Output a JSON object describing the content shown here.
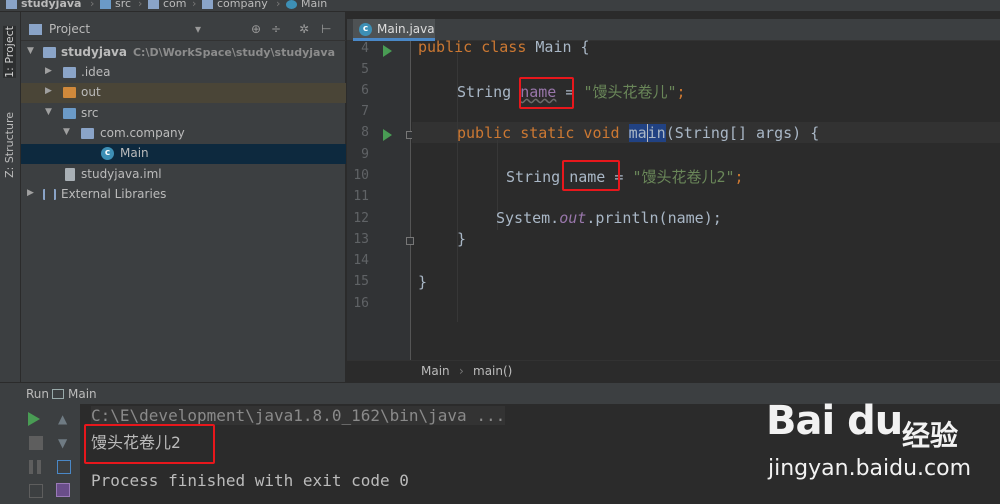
{
  "breadcrumbs": [
    "studyjava",
    "src",
    "com",
    "company",
    "Main"
  ],
  "toolstrip": {
    "project_tab": "1: Project",
    "structure_tab": "Z: Structure"
  },
  "project": {
    "title": "Project",
    "tools": {
      "dropdown": "▾",
      "target": "⊕",
      "collapse": "÷",
      "settings": "✲",
      "hide": "⊢"
    },
    "tree": [
      {
        "label": "studyjava",
        "path": "C:\\D\\WorkSpace\\study\\studyjava"
      },
      {
        "label": ".idea"
      },
      {
        "label": "out"
      },
      {
        "label": "src"
      },
      {
        "label": "com.company"
      },
      {
        "label": "Main"
      },
      {
        "label": "studyjava.iml"
      },
      {
        "label": "External Libraries"
      }
    ]
  },
  "editor": {
    "tab_label": "Main.java",
    "line_numbers": [
      "4",
      "5",
      "6",
      "7",
      "8",
      "9",
      "10",
      "11",
      "12",
      "13",
      "14",
      "15",
      "16"
    ],
    "code": {
      "l4a": "public class ",
      "l4b": "Main {",
      "l6a": "String ",
      "l6b": "name",
      "l6c": " = ",
      "l6d": "\"馒头花卷儿\"",
      "l6e": ";",
      "l8a": "public static void ",
      "l8b": "ma",
      "l8c": "in",
      "l8d": "(String[] args) {",
      "l10a": "String ",
      "l10b": "name",
      "l10c": " = ",
      "l10d": "\"馒头花卷儿2\"",
      "l10e": ";",
      "l12a": "System.",
      "l12b": "out",
      "l12c": ".println(name);",
      "l13": "}",
      "l15": "}"
    },
    "status": {
      "class_crumb": "Main",
      "method_crumb": "main()",
      "sep": "›"
    }
  },
  "run": {
    "title": "Run",
    "config_name": "Main",
    "console": {
      "command": "C:\\E\\development\\java1.8.0_162\\bin\\java ...",
      "output": "馒头花卷儿2",
      "exit": "Process finished with exit code 0"
    }
  },
  "watermark": {
    "logo": "Bai du",
    "zh": "经验",
    "url": "jingyan.baidu.com"
  },
  "colors": {
    "keyword": "#cc7832",
    "string": "#6a8759",
    "field": "#9876aa",
    "highlight_box": "#e8171c",
    "run_green": "#499c54"
  }
}
